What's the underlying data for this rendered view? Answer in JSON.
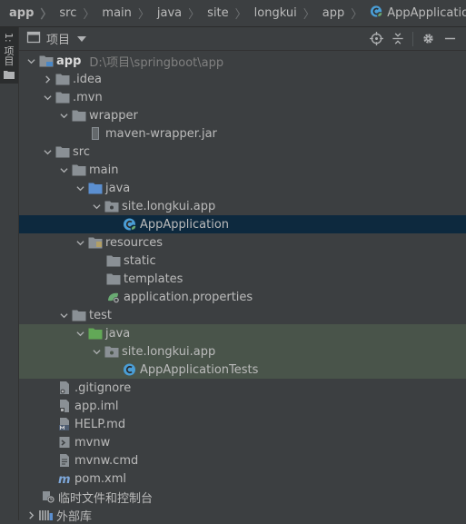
{
  "breadcrumb": [
    {
      "label": "app"
    },
    {
      "label": "src"
    },
    {
      "label": "main"
    },
    {
      "label": "java"
    },
    {
      "label": "site"
    },
    {
      "label": "longkui"
    },
    {
      "label": "app"
    },
    {
      "label": "AppApplication"
    }
  ],
  "tool_stripe": {
    "label": "1: 项目"
  },
  "project_panel": {
    "title": "项目"
  },
  "tree": {
    "app": {
      "label": "app",
      "path": "D:\\项目\\springboot\\app"
    },
    "idea": {
      "label": ".idea"
    },
    "mvn": {
      "label": ".mvn"
    },
    "wrapper": {
      "label": "wrapper"
    },
    "maven_wrapper_jar": {
      "label": "maven-wrapper.jar"
    },
    "src": {
      "label": "src"
    },
    "main": {
      "label": "main"
    },
    "main_java": {
      "label": "java"
    },
    "main_package": {
      "label": "site.longkui.app"
    },
    "app_application": {
      "label": "AppApplication"
    },
    "resources": {
      "label": "resources"
    },
    "static": {
      "label": "static"
    },
    "templates": {
      "label": "templates"
    },
    "application_properties": {
      "label": "application.properties"
    },
    "test": {
      "label": "test"
    },
    "test_java": {
      "label": "java"
    },
    "test_package": {
      "label": "site.longkui.app"
    },
    "app_application_tests": {
      "label": "AppApplicationTests"
    },
    "gitignore": {
      "label": ".gitignore"
    },
    "app_iml": {
      "label": "app.iml"
    },
    "help_md": {
      "label": "HELP.md"
    },
    "mvnw": {
      "label": "mvnw"
    },
    "mvnw_cmd": {
      "label": "mvnw.cmd"
    },
    "pom_xml": {
      "label": "pom.xml"
    },
    "scratches": {
      "label": "临时文件和控制台"
    },
    "external_libraries": {
      "label": "外部库"
    }
  },
  "colors": {
    "background": "#3c3f41",
    "selection": "#0d293e",
    "test_highlight": "#49544a",
    "folder": "#8a9095",
    "source_folder": "#5b8fd0",
    "test_folder": "#6a9955",
    "spring_class": "#4a9ed6",
    "spring_leaf": "#6aab73"
  }
}
